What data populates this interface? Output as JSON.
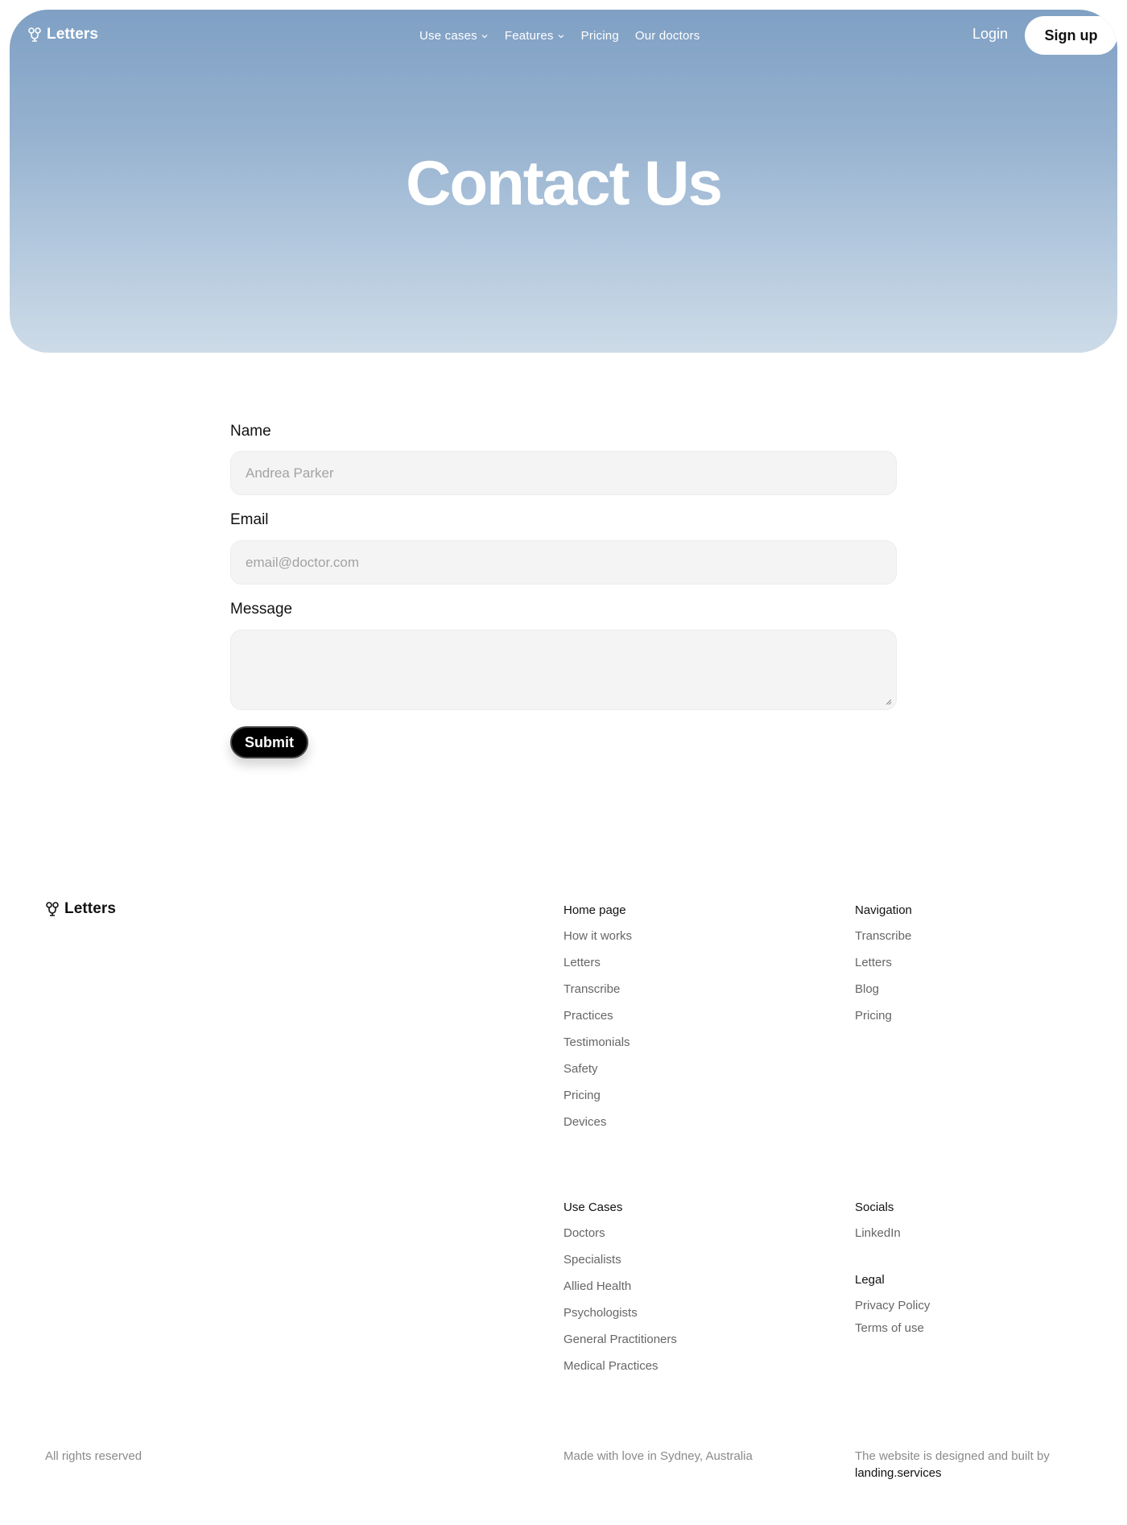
{
  "brand": {
    "name": "Letters",
    "accent": "#7fa0c4"
  },
  "nav": {
    "links": [
      {
        "label": "Use cases",
        "dropdown": true
      },
      {
        "label": "Features",
        "dropdown": true
      },
      {
        "label": "Pricing",
        "dropdown": false
      },
      {
        "label": "Our doctors",
        "dropdown": false
      }
    ],
    "login": "Login",
    "signup": "Sign up"
  },
  "hero": {
    "title": "Contact Us"
  },
  "form": {
    "name": {
      "label": "Name",
      "placeholder": "Andrea Parker",
      "value": ""
    },
    "email": {
      "label": "Email",
      "placeholder": "email@doctor.com",
      "value": ""
    },
    "message": {
      "label": "Message",
      "placeholder": "",
      "value": ""
    },
    "submit": "Submit"
  },
  "footer": {
    "logo": "Letters",
    "home": {
      "heading": "Home page",
      "links": [
        "How it works",
        "Letters",
        "Transcribe",
        "Practices",
        "Testimonials",
        "Safety",
        "Pricing",
        "Devices"
      ]
    },
    "navigation": {
      "heading": "Navigation",
      "links": [
        "Transcribe",
        "Letters",
        "Blog",
        "Pricing"
      ]
    },
    "use_cases": {
      "heading": "Use Cases",
      "links": [
        "Doctors",
        "Specialists",
        "Allied Health",
        "Psychologists",
        "General Practitioners",
        "Medical Practices"
      ]
    },
    "socials": {
      "heading": "Socials",
      "links": [
        "LinkedIn"
      ]
    },
    "legal": {
      "heading": "Legal",
      "links": [
        "Privacy Policy",
        "Terms of use"
      ]
    },
    "bottom": {
      "rights": "All rights reserved",
      "made": "Made with love in Sydney, Australia",
      "credit": "The website is designed and built by",
      "credit_link": "landing.services"
    }
  }
}
